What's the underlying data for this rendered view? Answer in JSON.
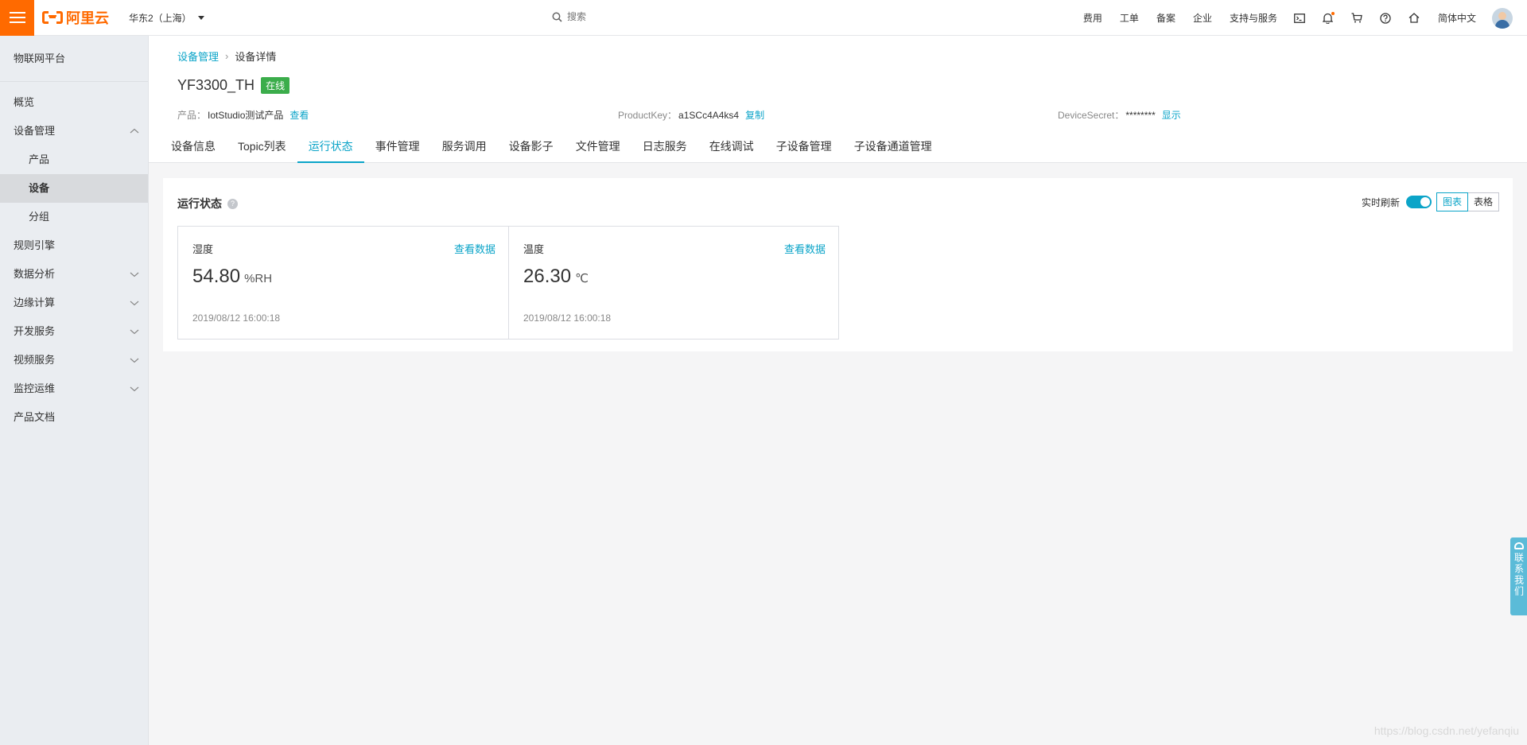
{
  "topbar": {
    "logo_text": "阿里云",
    "region": "华东2（上海）",
    "search_placeholder": "搜索",
    "links": [
      "费用",
      "工单",
      "备案",
      "企业",
      "支持与服务"
    ],
    "language": "简体中文"
  },
  "sidebar": {
    "title": "物联网平台",
    "items": [
      {
        "label": "概览"
      },
      {
        "label": "设备管理"
      },
      {
        "label": "产品"
      },
      {
        "label": "设备"
      },
      {
        "label": "分组"
      },
      {
        "label": "规则引擎"
      },
      {
        "label": "数据分析"
      },
      {
        "label": "边缘计算"
      },
      {
        "label": "开发服务"
      },
      {
        "label": "视频服务"
      },
      {
        "label": "监控运维"
      },
      {
        "label": "产品文档"
      }
    ]
  },
  "breadcrumb": {
    "parent": "设备管理",
    "sep": "›",
    "current": "设备详情"
  },
  "device": {
    "name": "YF3300_TH",
    "status": "在线",
    "product_key_label": "产品：",
    "product_value": "IotStudio测试产品",
    "product_action": "查看",
    "productkey_label": "ProductKey：",
    "productkey_value": "a1SCc4A4ks4",
    "productkey_action": "复制",
    "secret_label": "DeviceSecret：",
    "secret_value": "********",
    "secret_action": "显示"
  },
  "tabs": [
    "设备信息",
    "Topic列表",
    "运行状态",
    "事件管理",
    "服务调用",
    "设备影子",
    "文件管理",
    "日志服务",
    "在线调试",
    "子设备管理",
    "子设备通道管理"
  ],
  "active_tab": "运行状态",
  "panel": {
    "title": "运行状态",
    "help": "?",
    "realtime_label": "实时刷新",
    "realtime_on": true,
    "view_chart": "图表",
    "view_table": "表格"
  },
  "cards": [
    {
      "title": "湿度",
      "link": "查看数据",
      "value": "54.80",
      "unit": "%RH",
      "time": "2019/08/12 16:00:18"
    },
    {
      "title": "温度",
      "link": "查看数据",
      "value": "26.30",
      "unit": "℃",
      "time": "2019/08/12 16:00:18"
    }
  ],
  "contact": "联系我们",
  "watermark": "https://blog.csdn.net/yefanqiu",
  "colors": {
    "brand": "#ff6a00",
    "accent": "#0ba4c8",
    "online": "#3bad4b"
  }
}
